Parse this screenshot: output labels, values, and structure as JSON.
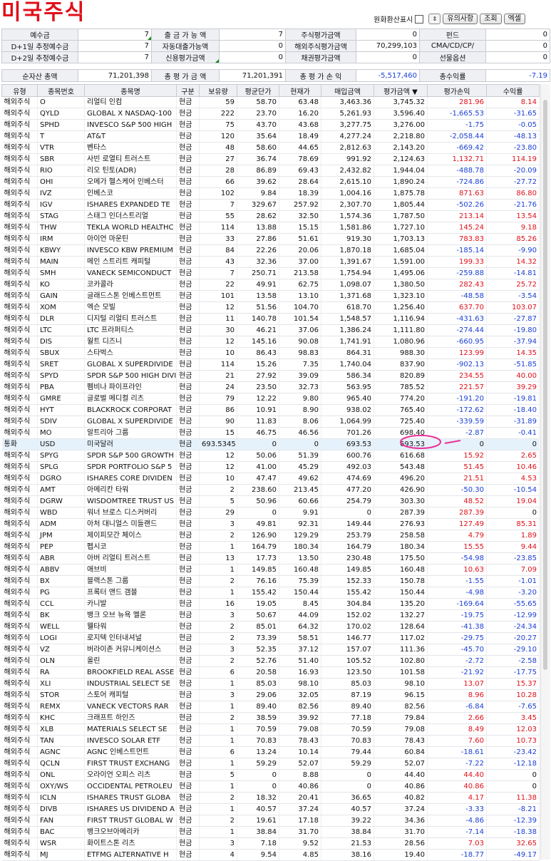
{
  "title": "미국주식",
  "controls": {
    "currency_label": "원화환산표시",
    "notice": "유의사항",
    "lookup": "조회",
    "excel": "엑셀"
  },
  "summary": [
    [
      "예수금",
      "7",
      "출 금 가 능 액",
      "7",
      "주식평가금액",
      "0",
      "펀드",
      "0"
    ],
    [
      "D+1일 추정예수금",
      "7",
      "자동대출가능액",
      "0",
      "해외주식평가금액",
      "70,299,103",
      "CMA/CD/CP/",
      "0"
    ],
    [
      "D+2일 추정예수금",
      "7",
      "신용평가금액",
      "0",
      "채권평가금액",
      "0",
      "선물옵션",
      "0"
    ]
  ],
  "net": [
    "순자산 총액",
    "71,201,398",
    "총 평 가 금 액",
    "71,201,391",
    "총 평 가 손 익",
    "-5,517,460",
    "총수익률",
    "-7.19"
  ],
  "columns": [
    "유형",
    "종목번호",
    "종목명",
    "구분",
    "보유량",
    "평균단가",
    "현재가",
    "매입금액",
    "평가금액 ▼",
    "평가손익",
    "수익률"
  ],
  "rows": [
    [
      "해외주식",
      "O",
      "리얼티 인컴",
      "현금",
      "59",
      "58.70",
      "63.48",
      "3,463.36",
      "3,745.32",
      "281.96",
      "8.14"
    ],
    [
      "해외주식",
      "QYLD",
      "GLOBAL X NASDAQ-100",
      "현금",
      "222",
      "23.70",
      "16.20",
      "5,261.93",
      "3,596.40",
      "-1,665.53",
      "-31.65"
    ],
    [
      "해외주식",
      "SPHD",
      "INVESCO S&P 500 HIGH",
      "현금",
      "75",
      "43.70",
      "43.68",
      "3,277.75",
      "3,276.00",
      "-1.75",
      "-0.05"
    ],
    [
      "해외주식",
      "T",
      "AT&T",
      "현금",
      "120",
      "35.64",
      "18.49",
      "4,277.24",
      "2,218.80",
      "-2,058.44",
      "-48.13"
    ],
    [
      "해외주식",
      "VTR",
      "벤타스",
      "현금",
      "48",
      "58.60",
      "44.65",
      "2,812.63",
      "2,143.20",
      "-669.42",
      "-23.80"
    ],
    [
      "해외주식",
      "SBR",
      "사빈 로열티 트러스트",
      "현금",
      "27",
      "36.74",
      "78.69",
      "991.92",
      "2,124.63",
      "1,132.71",
      "114.19"
    ],
    [
      "해외주식",
      "RIO",
      "리오 틴토(ADR)",
      "현금",
      "28",
      "86.89",
      "69.43",
      "2,432.82",
      "1,944.04",
      "-488.78",
      "-20.09"
    ],
    [
      "해외주식",
      "OHI",
      "오메가 헬스케어 인베스터",
      "현금",
      "66",
      "39.62",
      "28.64",
      "2,615.10",
      "1,890.24",
      "-724.86",
      "-27.72"
    ],
    [
      "해외주식",
      "IVZ",
      "인베스코",
      "현금",
      "102",
      "9.84",
      "18.39",
      "1,004.16",
      "1,875.78",
      "871.63",
      "86.80"
    ],
    [
      "해외주식",
      "IGV",
      "ISHARES EXPANDED TE",
      "현금",
      "7",
      "329.67",
      "257.92",
      "2,307.70",
      "1,805.44",
      "-502.26",
      "-21.76"
    ],
    [
      "해외주식",
      "STAG",
      "스태그 인더스트리얼",
      "현금",
      "55",
      "28.62",
      "32.50",
      "1,574.36",
      "1,787.50",
      "213.14",
      "13.54"
    ],
    [
      "해외주식",
      "THW",
      "TEKLA WORLD HEALTHC",
      "현금",
      "114",
      "13.88",
      "15.15",
      "1,581.86",
      "1,727.10",
      "145.24",
      "9.18"
    ],
    [
      "해외주식",
      "IRM",
      "아이언 마운틴",
      "현금",
      "33",
      "27.86",
      "51.61",
      "919.30",
      "1,703.13",
      "783.83",
      "85.26"
    ],
    [
      "해외주식",
      "KBWY",
      "INVESCO KBW PREMIUM",
      "현금",
      "84",
      "22.26",
      "20.06",
      "1,870.18",
      "1,685.04",
      "-185.14",
      "-9.90"
    ],
    [
      "해외주식",
      "MAIN",
      "메인 스트리트 캐피털",
      "현금",
      "43",
      "32.36",
      "37.00",
      "1,391.67",
      "1,591.00",
      "199.33",
      "14.32"
    ],
    [
      "해외주식",
      "SMH",
      "VANECK SEMICONDUCT",
      "현금",
      "7",
      "250.71",
      "213.58",
      "1,754.94",
      "1,495.06",
      "-259.88",
      "-14.81"
    ],
    [
      "해외주식",
      "KO",
      "코카콜라",
      "현금",
      "22",
      "49.91",
      "62.75",
      "1,098.07",
      "1,380.50",
      "282.43",
      "25.72"
    ],
    [
      "해외주식",
      "GAIN",
      "글래드스톤 인베스트먼트",
      "현금",
      "101",
      "13.58",
      "13.10",
      "1,371.68",
      "1,323.10",
      "-48.58",
      "-3.54"
    ],
    [
      "해외주식",
      "XOM",
      "엑슨 모빌",
      "현금",
      "12",
      "51.56",
      "104.70",
      "618.70",
      "1,256.40",
      "637.70",
      "103.07"
    ],
    [
      "해외주식",
      "DLR",
      "디지털 리얼티 트러스트",
      "현금",
      "11",
      "140.78",
      "101.54",
      "1,548.57",
      "1,116.94",
      "-431.63",
      "-27.87"
    ],
    [
      "해외주식",
      "LTC",
      "LTC 프라퍼티스",
      "현금",
      "30",
      "46.21",
      "37.06",
      "1,386.24",
      "1,111.80",
      "-274.44",
      "-19.80"
    ],
    [
      "해외주식",
      "DIS",
      "월트 디즈니",
      "현금",
      "12",
      "145.16",
      "90.08",
      "1,741.91",
      "1,080.96",
      "-660.95",
      "-37.94"
    ],
    [
      "해외주식",
      "SBUX",
      "스타벅스",
      "현금",
      "10",
      "86.43",
      "98.83",
      "864.31",
      "988.30",
      "123.99",
      "14.35"
    ],
    [
      "해외주식",
      "SRET",
      "GLOBAL X SUPERDIVIDE",
      "현금",
      "114",
      "15.26",
      "7.35",
      "1,740.04",
      "837.90",
      "-902.13",
      "-51.85"
    ],
    [
      "해외주식",
      "SPYD",
      "SPDR S&P 500 HIGH DIVI",
      "현금",
      "21",
      "27.92",
      "39.09",
      "586.34",
      "820.89",
      "234.55",
      "40.00"
    ],
    [
      "해외주식",
      "PBA",
      "펨비나 파이프라인",
      "현금",
      "24",
      "23.50",
      "32.73",
      "563.95",
      "785.52",
      "221.57",
      "39.29"
    ],
    [
      "해외주식",
      "GMRE",
      "글로벌 메디컬 리츠",
      "현금",
      "79",
      "12.22",
      "9.80",
      "965.40",
      "774.20",
      "-191.20",
      "-19.81"
    ],
    [
      "해외주식",
      "HYT",
      "BLACKROCK CORPORAT",
      "현금",
      "86",
      "10.91",
      "8.90",
      "938.02",
      "765.40",
      "-172.62",
      "-18.40"
    ],
    [
      "해외주식",
      "SDIV",
      "GLOBAL X SUPERDIVIDE",
      "현금",
      "90",
      "11.83",
      "8.06",
      "1,064.99",
      "725.40",
      "-339.59",
      "-31.89"
    ],
    [
      "해외주식",
      "MO",
      "알트리아 그룹",
      "현금",
      "15",
      "46.75",
      "46.56",
      "701.26",
      "698.40",
      "-2.87",
      "-0.41"
    ],
    [
      "통화",
      "USD",
      "미국달러",
      "현금",
      "693.5345",
      "0",
      "0",
      "693.53",
      "693.53",
      "0",
      "0"
    ],
    [
      "해외주식",
      "SPYG",
      "SPDR S&P 500 GROWTH",
      "현금",
      "12",
      "50.06",
      "51.39",
      "600.76",
      "616.68",
      "15.92",
      "2.65"
    ],
    [
      "해외주식",
      "SPLG",
      "SPDR PORTFOLIO S&P 5",
      "현금",
      "12",
      "41.00",
      "45.29",
      "492.03",
      "543.48",
      "51.45",
      "10.46"
    ],
    [
      "해외주식",
      "DGRO",
      "ISHARES CORE DIVIDEN",
      "현금",
      "10",
      "47.47",
      "49.62",
      "474.69",
      "496.20",
      "21.51",
      "4.53"
    ],
    [
      "해외주식",
      "AMT",
      "아메리칸 타워",
      "현금",
      "2",
      "238.60",
      "213.45",
      "477.20",
      "426.90",
      "-50.30",
      "-10.54"
    ],
    [
      "해외주식",
      "DGRW",
      "WISDOMTREE TRUST US",
      "현금",
      "5",
      "50.96",
      "60.66",
      "254.79",
      "303.30",
      "48.52",
      "19.04"
    ],
    [
      "해외주식",
      "WBD",
      "워너 브로스 디스커버리",
      "현금",
      "29",
      "0",
      "9.91",
      "0",
      "287.39",
      "287.39",
      "0"
    ],
    [
      "해외주식",
      "ADM",
      "아처 대니얼스 미들랜드",
      "현금",
      "3",
      "49.81",
      "92.31",
      "149.44",
      "276.93",
      "127.49",
      "85.31"
    ],
    [
      "해외주식",
      "JPM",
      "제이피모간 체이스",
      "현금",
      "2",
      "126.90",
      "129.29",
      "253.79",
      "258.58",
      "4.79",
      "1.89"
    ],
    [
      "해외주식",
      "PEP",
      "펩시코",
      "현금",
      "1",
      "164.79",
      "180.34",
      "164.79",
      "180.34",
      "15.55",
      "9.44"
    ],
    [
      "해외주식",
      "ABR",
      "아버 리얼티 트러스트",
      "현금",
      "13",
      "17.73",
      "13.50",
      "230.48",
      "175.50",
      "-54.98",
      "-23.85"
    ],
    [
      "해외주식",
      "ABBV",
      "애브비",
      "현금",
      "1",
      "149.85",
      "160.48",
      "149.85",
      "160.48",
      "10.63",
      "7.09"
    ],
    [
      "해외주식",
      "BX",
      "블랙스톤 그룹",
      "현금",
      "2",
      "76.16",
      "75.39",
      "152.33",
      "150.78",
      "-1.55",
      "-1.01"
    ],
    [
      "해외주식",
      "PG",
      "프록터 앤드 갬블",
      "현금",
      "1",
      "155.42",
      "150.44",
      "155.42",
      "150.44",
      "-4.98",
      "-3.20"
    ],
    [
      "해외주식",
      "CCL",
      "카니발",
      "현금",
      "16",
      "19.05",
      "8.45",
      "304.84",
      "135.20",
      "-169.64",
      "-55.65"
    ],
    [
      "해외주식",
      "BK",
      "뱅크 오브 뉴욕 멜론",
      "현금",
      "3",
      "50.67",
      "44.09",
      "152.02",
      "132.27",
      "-19.75",
      "-12.99"
    ],
    [
      "해외주식",
      "WELL",
      "웰타워",
      "현금",
      "2",
      "85.01",
      "64.32",
      "170.02",
      "128.64",
      "-41.38",
      "-24.34"
    ],
    [
      "해외주식",
      "LOGI",
      "로지텍 인터내셔널",
      "현금",
      "2",
      "73.39",
      "58.51",
      "146.77",
      "117.02",
      "-29.75",
      "-20.27"
    ],
    [
      "해외주식",
      "VZ",
      "버라이존 커뮤니케이션스",
      "현금",
      "3",
      "52.35",
      "37.12",
      "157.07",
      "111.36",
      "-45.70",
      "-29.10"
    ],
    [
      "해외주식",
      "OLN",
      "올린",
      "현금",
      "2",
      "52.76",
      "51.40",
      "105.52",
      "102.80",
      "-2.72",
      "-2.58"
    ],
    [
      "해외주식",
      "RA",
      "BROOKFIELD REAL ASSE",
      "현금",
      "6",
      "20.58",
      "16.93",
      "123.50",
      "101.58",
      "-21.92",
      "-17.75"
    ],
    [
      "해외주식",
      "XLI",
      "INDUSTRIAL SELECT SE",
      "현금",
      "1",
      "85.03",
      "98.10",
      "85.03",
      "98.10",
      "13.07",
      "15.37"
    ],
    [
      "해외주식",
      "STOR",
      "스토어 캐피털",
      "현금",
      "3",
      "29.06",
      "32.05",
      "87.19",
      "96.15",
      "8.96",
      "10.28"
    ],
    [
      "해외주식",
      "REMX",
      "VANECK VECTORS RAR",
      "현금",
      "1",
      "89.40",
      "82.56",
      "89.40",
      "82.56",
      "-6.84",
      "-7.65"
    ],
    [
      "해외주식",
      "KHC",
      "크래프트 하인즈",
      "현금",
      "2",
      "38.59",
      "39.92",
      "77.18",
      "79.84",
      "2.66",
      "3.45"
    ],
    [
      "해외주식",
      "XLB",
      "MATERIALS SELECT SE",
      "현금",
      "1",
      "70.59",
      "79.08",
      "70.59",
      "79.08",
      "8.49",
      "12.03"
    ],
    [
      "해외주식",
      "TAN",
      "INVESCO SOLAR ETF",
      "현금",
      "1",
      "70.83",
      "78.43",
      "70.83",
      "78.43",
      "7.60",
      "10.73"
    ],
    [
      "해외주식",
      "AGNC",
      "AGNC 인베스트먼트",
      "현금",
      "6",
      "13.24",
      "10.14",
      "79.44",
      "60.84",
      "-18.61",
      "-23.42"
    ],
    [
      "해외주식",
      "QCLN",
      "FIRST TRUST EXCHANG",
      "현금",
      "1",
      "59.29",
      "52.07",
      "59.29",
      "52.07",
      "-7.22",
      "-12.18"
    ],
    [
      "해외주식",
      "ONL",
      "오라이언 오피스 리츠",
      "현금",
      "5",
      "0",
      "8.88",
      "0",
      "44.40",
      "44.40",
      "0"
    ],
    [
      "해외주식",
      "OXY/WS",
      "OCCIDENTAL PETROLEU",
      "현금",
      "1",
      "0",
      "40.86",
      "0",
      "40.86",
      "40.86",
      "0"
    ],
    [
      "해외주식",
      "ICLN",
      "ISHARES TRUST GLOBA",
      "현금",
      "2",
      "18.32",
      "20.41",
      "36.65",
      "40.82",
      "4.17",
      "11.38"
    ],
    [
      "해외주식",
      "DIVB",
      "ISHARES US DIVIDEND A",
      "현금",
      "1",
      "40.57",
      "37.24",
      "40.57",
      "37.24",
      "-3.33",
      "-8.21"
    ],
    [
      "해외주식",
      "FAN",
      "FIRST TRUST GLOBAL W",
      "현금",
      "2",
      "19.61",
      "17.18",
      "39.22",
      "34.36",
      "-4.86",
      "-12.39"
    ],
    [
      "해외주식",
      "BAC",
      "뱅크오브아메리카",
      "현금",
      "1",
      "38.84",
      "31.70",
      "38.84",
      "31.70",
      "-7.14",
      "-18.38"
    ],
    [
      "해외주식",
      "WSR",
      "화이트스톤 리츠",
      "현금",
      "3",
      "7.18",
      "9.52",
      "21.53",
      "28.56",
      "7.03",
      "32.65"
    ],
    [
      "해외주식",
      "MJ",
      "ETFMG ALTERNATIVE H",
      "현금",
      "4",
      "9.54",
      "4.85",
      "38.16",
      "19.40",
      "-18.77",
      "-49.17"
    ]
  ],
  "highlight_index": 30
}
